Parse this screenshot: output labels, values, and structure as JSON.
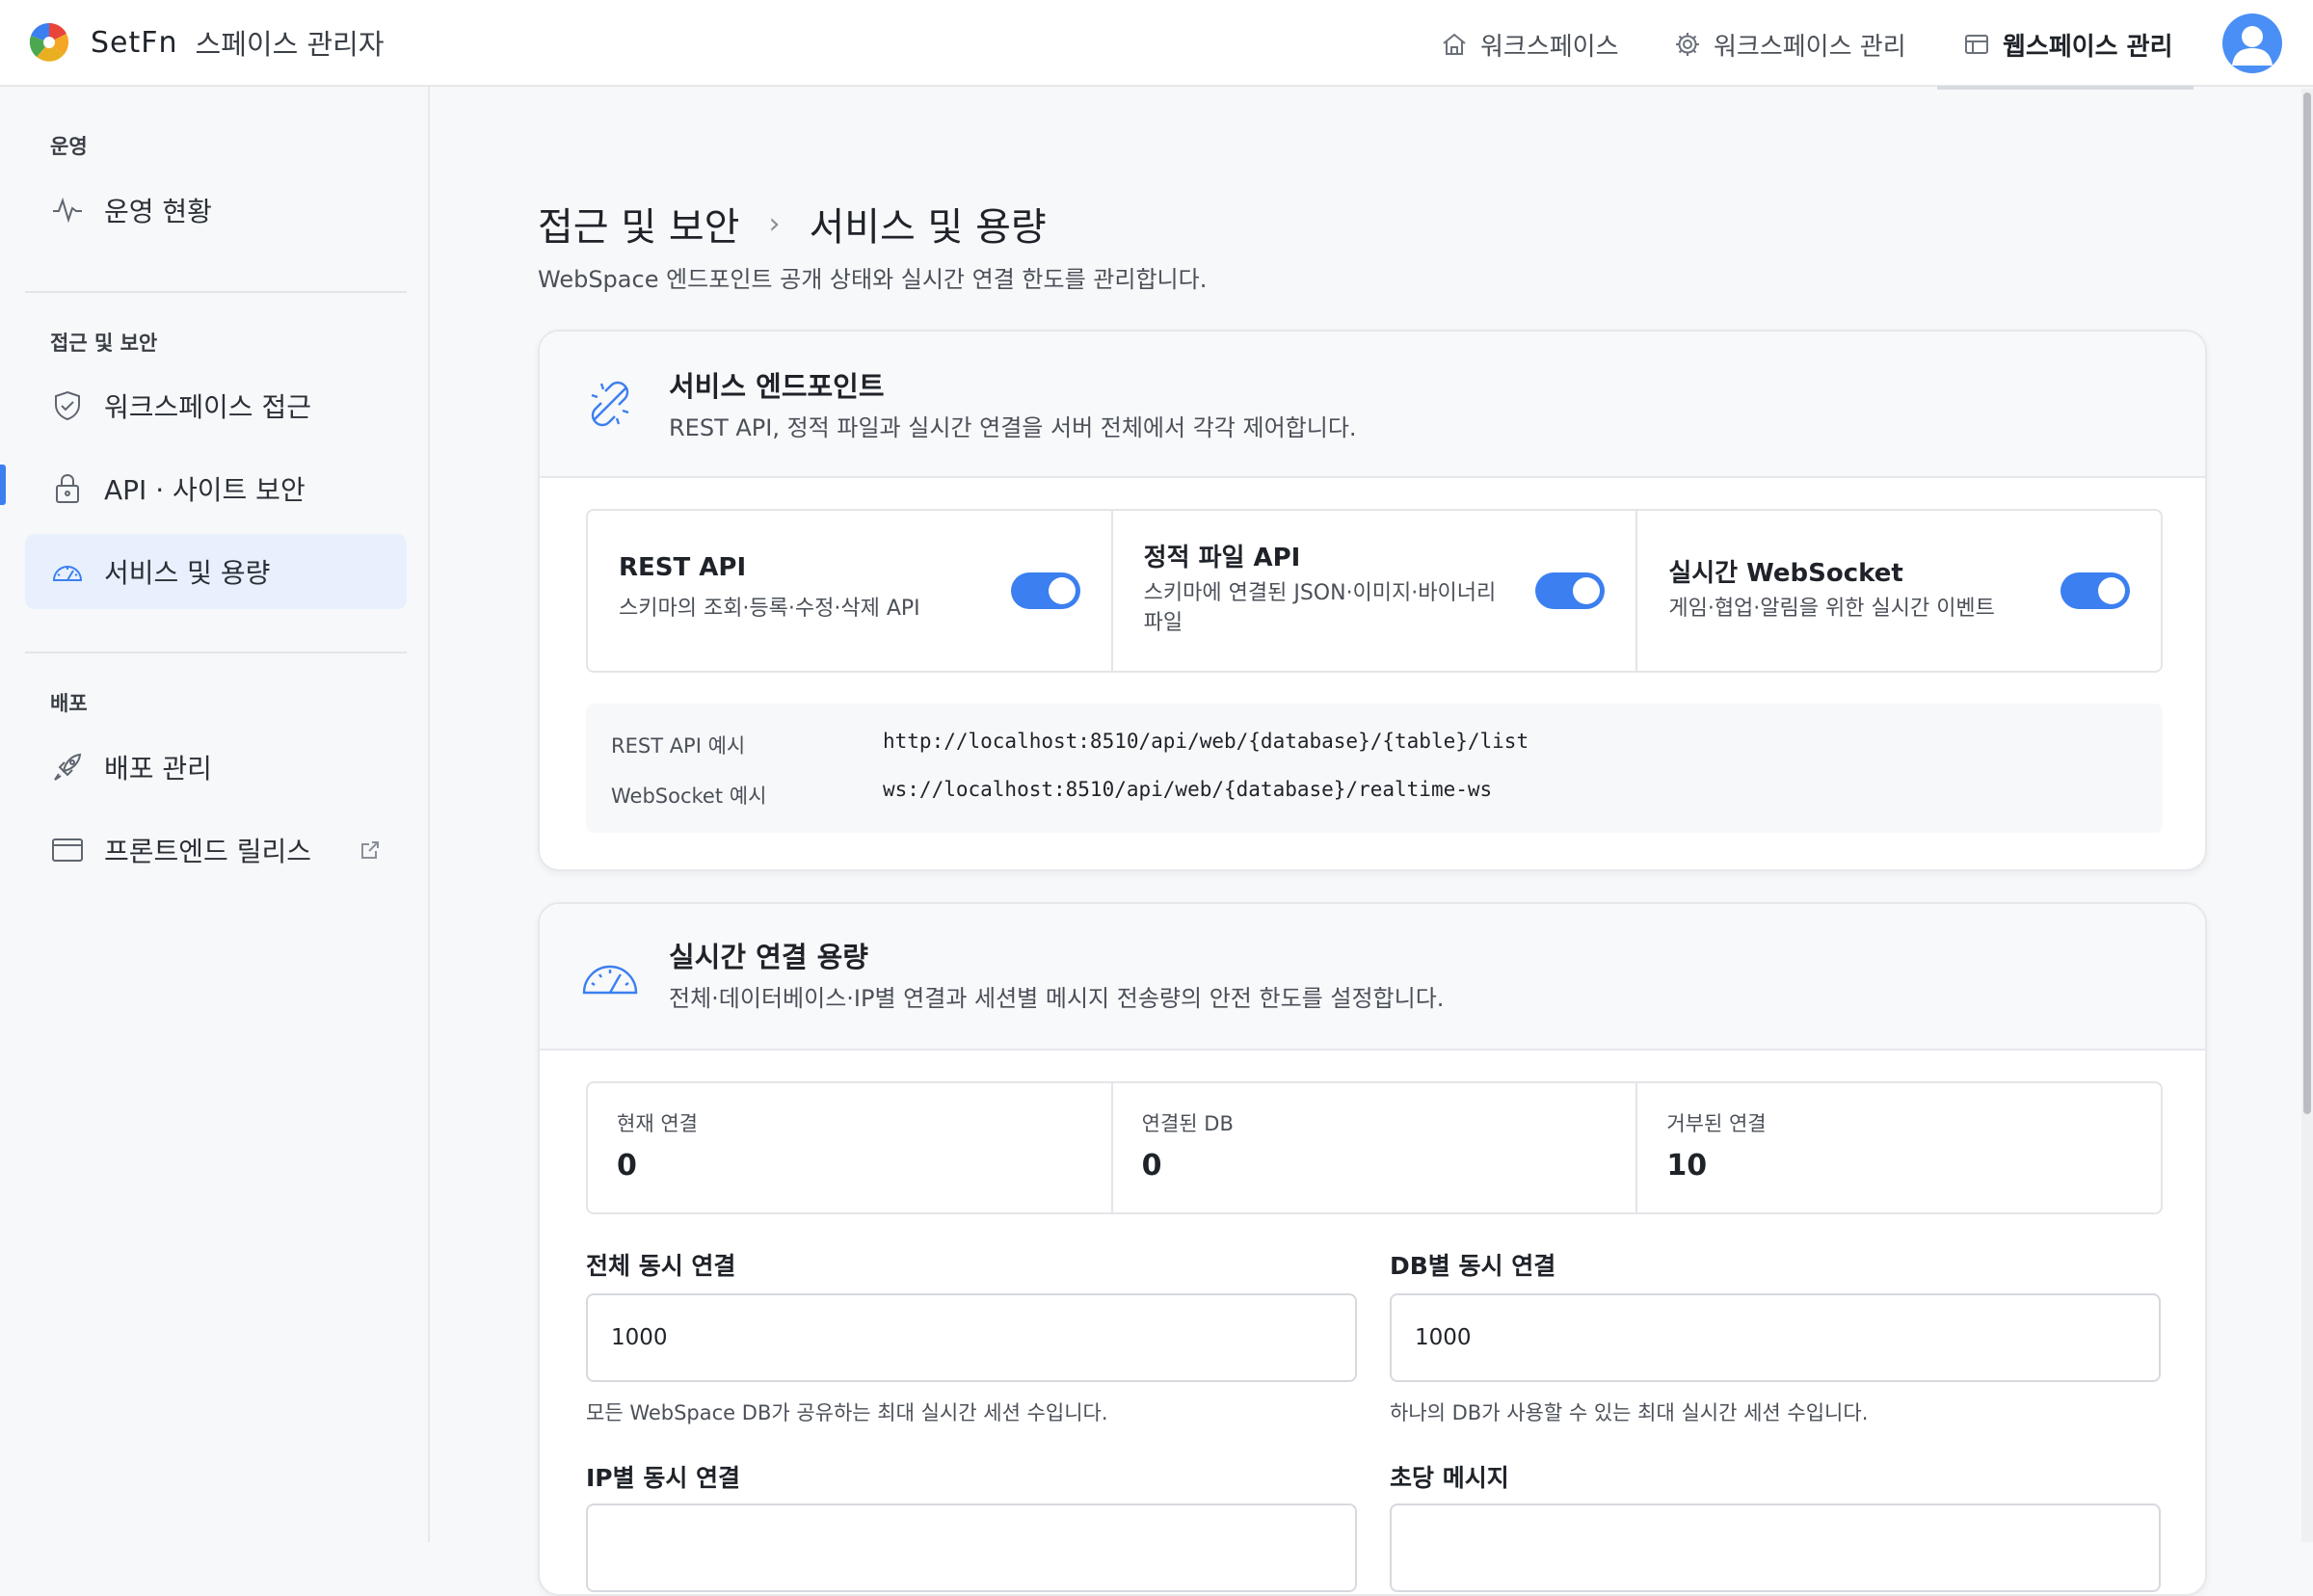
{
  "header": {
    "brand_name": "SetFn",
    "brand_subtitle": "스페이스 관리자",
    "nav": [
      {
        "label": "워크스페이스",
        "icon": "home-icon"
      },
      {
        "label": "워크스페이스 관리",
        "icon": "gear-icon"
      },
      {
        "label": "웹스페이스 관리",
        "icon": "layout-icon",
        "active": true
      }
    ],
    "avatar_icon": "user-avatar-icon"
  },
  "sidebar": {
    "sections": [
      {
        "title": "운영",
        "items": [
          {
            "label": "운영 현황",
            "icon": "activity-icon"
          }
        ]
      },
      {
        "title": "접근 및 보안",
        "items": [
          {
            "label": "워크스페이스 접근",
            "icon": "shield-icon"
          },
          {
            "label": "API · 사이트 보안",
            "icon": "lock-icon"
          },
          {
            "label": "서비스 및 용량",
            "icon": "gauge-icon",
            "active": true
          }
        ]
      },
      {
        "title": "배포",
        "items": [
          {
            "label": "배포 관리",
            "icon": "rocket-icon"
          },
          {
            "label": "프론트엔드 릴리스",
            "icon": "window-icon",
            "external": true
          }
        ]
      }
    ]
  },
  "page": {
    "breadcrumb": [
      "접근 및 보안",
      "서비스 및 용량"
    ],
    "description": "WebSpace 엔드포인트 공개 상태와 실시간 연결 한도를 관리합니다."
  },
  "endpoints": {
    "title": "서비스 엔드포인트",
    "subtitle": "REST API, 정적 파일과 실시간 연결을 서버 전체에서 각각 제어합니다.",
    "services": [
      {
        "name": "REST API",
        "desc": "스키마의 조회·등록·수정·삭제 API",
        "enabled": true
      },
      {
        "name": "정적 파일 API",
        "desc": "스키마에 연결된 JSON·이미지·바이너리 파일",
        "enabled": true
      },
      {
        "name": "실시간 WebSocket",
        "desc": "게임·협업·알림을 위한 실시간 이벤트",
        "enabled": true
      }
    ],
    "examples": [
      {
        "label": "REST API 예시",
        "value": "http://localhost:8510/api/web/{database}/{table}/list"
      },
      {
        "label": "WebSocket 예시",
        "value": "ws://localhost:8510/api/web/{database}/realtime-ws"
      }
    ]
  },
  "capacity": {
    "title": "실시간 연결 용량",
    "subtitle": "전체·데이터베이스·IP별 연결과 세션별 메시지 전송량의 안전 한도를 설정합니다.",
    "stats": [
      {
        "label": "현재 연결",
        "value": "0"
      },
      {
        "label": "연결된 DB",
        "value": "0"
      },
      {
        "label": "거부된 연결",
        "value": "10"
      }
    ],
    "fields": [
      {
        "label": "전체 동시 연결",
        "value": "1000",
        "help": "모든 WebSpace DB가 공유하는 최대 실시간 세션 수입니다."
      },
      {
        "label": "DB별 동시 연결",
        "value": "1000",
        "help": "하나의 DB가 사용할 수 있는 최대 실시간 세션 수입니다."
      },
      {
        "label": "IP별 동시 연결",
        "value": "",
        "help": ""
      },
      {
        "label": "초당 메시지",
        "value": "",
        "help": ""
      }
    ]
  },
  "colors": {
    "accent": "#3b7ff0",
    "active_bg": "#e8f0fd",
    "border": "#e6e8eb"
  }
}
